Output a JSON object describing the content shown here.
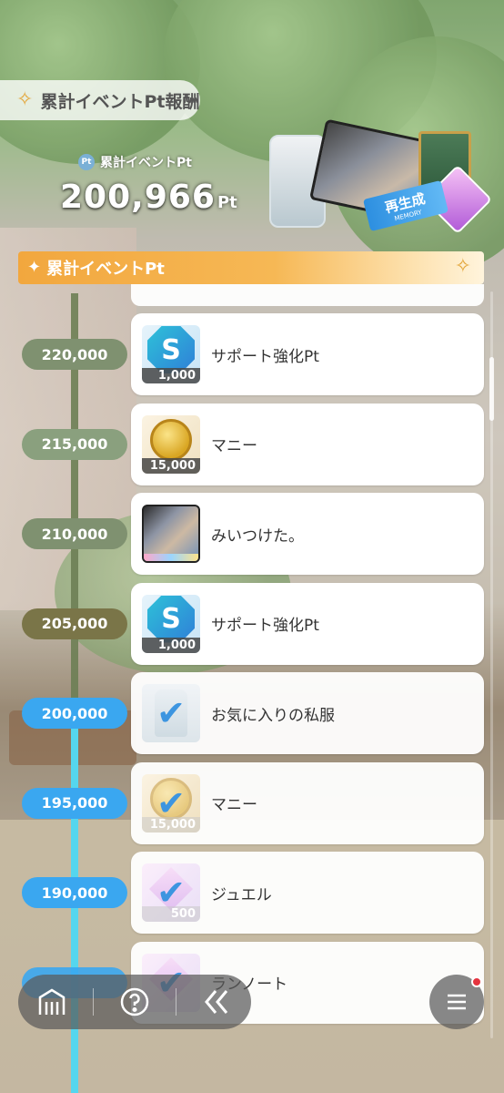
{
  "header": {
    "title": "累計イベントPt報酬",
    "sparkle_icon": "sparkle-icon"
  },
  "points": {
    "label": "累計イベントPt",
    "icon_text": "Pt",
    "value": "200,966",
    "unit": "Pt"
  },
  "reward_art": {
    "ticket_text": "再生成",
    "ticket_sub": "MEMORY"
  },
  "section": {
    "title": "累計イベントPt"
  },
  "rewards": [
    {
      "milestone": "220,000",
      "name": "サポート強化Pt",
      "icon": "support-pt-icon",
      "qty": "1,000",
      "done": false,
      "milestone_color": "#7f9170"
    },
    {
      "milestone": "215,000",
      "name": "マニー",
      "icon": "money-coin-icon",
      "qty": "15,000",
      "done": false,
      "milestone_color": "#8aa07e"
    },
    {
      "milestone": "210,000",
      "name": "みいつけた。",
      "icon": "memory-photo-icon",
      "qty": "",
      "done": false,
      "milestone_color": "#7f9170"
    },
    {
      "milestone": "205,000",
      "name": "サポート強化Pt",
      "icon": "support-pt-icon",
      "qty": "1,000",
      "done": false,
      "milestone_color": "#7a7548"
    },
    {
      "milestone": "200,000",
      "name": "お気に入りの私服",
      "icon": "costume-icon",
      "qty": "",
      "done": true,
      "milestone_color": "#3aa7f0"
    },
    {
      "milestone": "195,000",
      "name": "マニー",
      "icon": "money-coin-icon",
      "qty": "15,000",
      "done": true,
      "milestone_color": "#3aa7f0"
    },
    {
      "milestone": "190,000",
      "name": "ジュエル",
      "icon": "jewel-icon",
      "qty": "500",
      "done": true,
      "milestone_color": "#3aa7f0"
    },
    {
      "milestone": "",
      "name": "ランノート",
      "icon": "note-icon",
      "qty": "",
      "done": true,
      "milestone_color": "#3aa7f0"
    }
  ],
  "nav": {
    "home_icon": "home-icon",
    "help_icon": "help-icon",
    "back_icon": "back-icon",
    "menu_icon": "menu-icon"
  }
}
